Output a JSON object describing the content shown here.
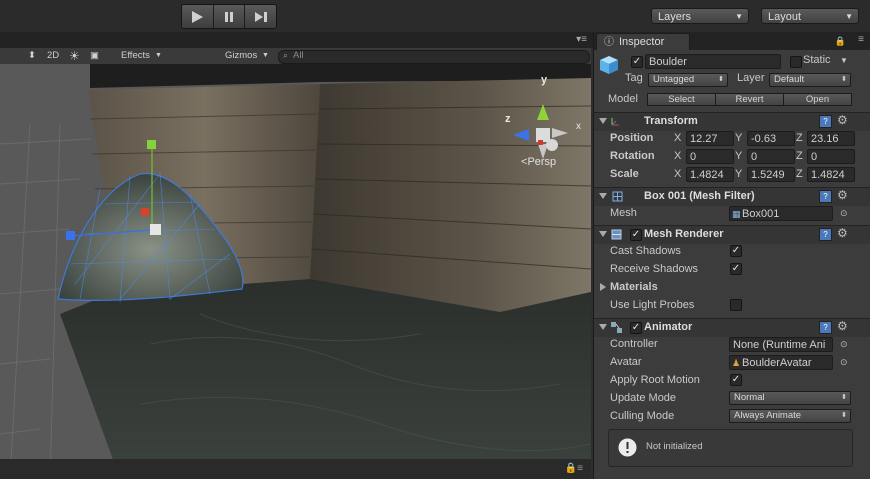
{
  "toolbar": {
    "layers_label": "Layers",
    "layout_label": "Layout"
  },
  "scene": {
    "shading_mode": "",
    "mode_2d": "2D",
    "effects_label": "Effects",
    "gizmos_label": "Gizmos",
    "search_placeholder": "All",
    "persp_label": "Persp",
    "axis_x": "x",
    "axis_y": "y",
    "axis_z": "z"
  },
  "inspector": {
    "tab_label": "Inspector",
    "object_name": "Boulder",
    "static_label": "Static",
    "tag_label": "Tag",
    "tag_value": "Untagged",
    "layer_label": "Layer",
    "layer_value": "Default",
    "model_label": "Model",
    "model_buttons": [
      "Select",
      "Revert",
      "Open"
    ],
    "transform": {
      "title": "Transform",
      "rows": [
        {
          "label": "Position",
          "x": "12.27",
          "y": "-0.63",
          "z": "23.16"
        },
        {
          "label": "Rotation",
          "x": "0",
          "y": "0",
          "z": "0"
        },
        {
          "label": "Scale",
          "x": "1.4824",
          "y": "1.5249",
          "z": "1.4824"
        }
      ]
    },
    "mesh_filter": {
      "title": "Box 001 (Mesh Filter)",
      "mesh_label": "Mesh",
      "mesh_value": "Box001"
    },
    "mesh_renderer": {
      "title": "Mesh Renderer",
      "cast_shadows_label": "Cast Shadows",
      "cast_shadows": true,
      "receive_shadows_label": "Receive Shadows",
      "receive_shadows": true,
      "materials_label": "Materials",
      "light_probes_label": "Use Light Probes",
      "light_probes": false
    },
    "animator": {
      "title": "Animator",
      "controller_label": "Controller",
      "controller_value": "None (Runtime Ani",
      "avatar_label": "Avatar",
      "avatar_value": "BoulderAvatar",
      "root_motion_label": "Apply Root Motion",
      "root_motion": true,
      "update_mode_label": "Update Mode",
      "update_mode_value": "Normal",
      "culling_mode_label": "Culling Mode",
      "culling_mode_value": "Always Animate",
      "status_text": "Not initialized"
    }
  }
}
